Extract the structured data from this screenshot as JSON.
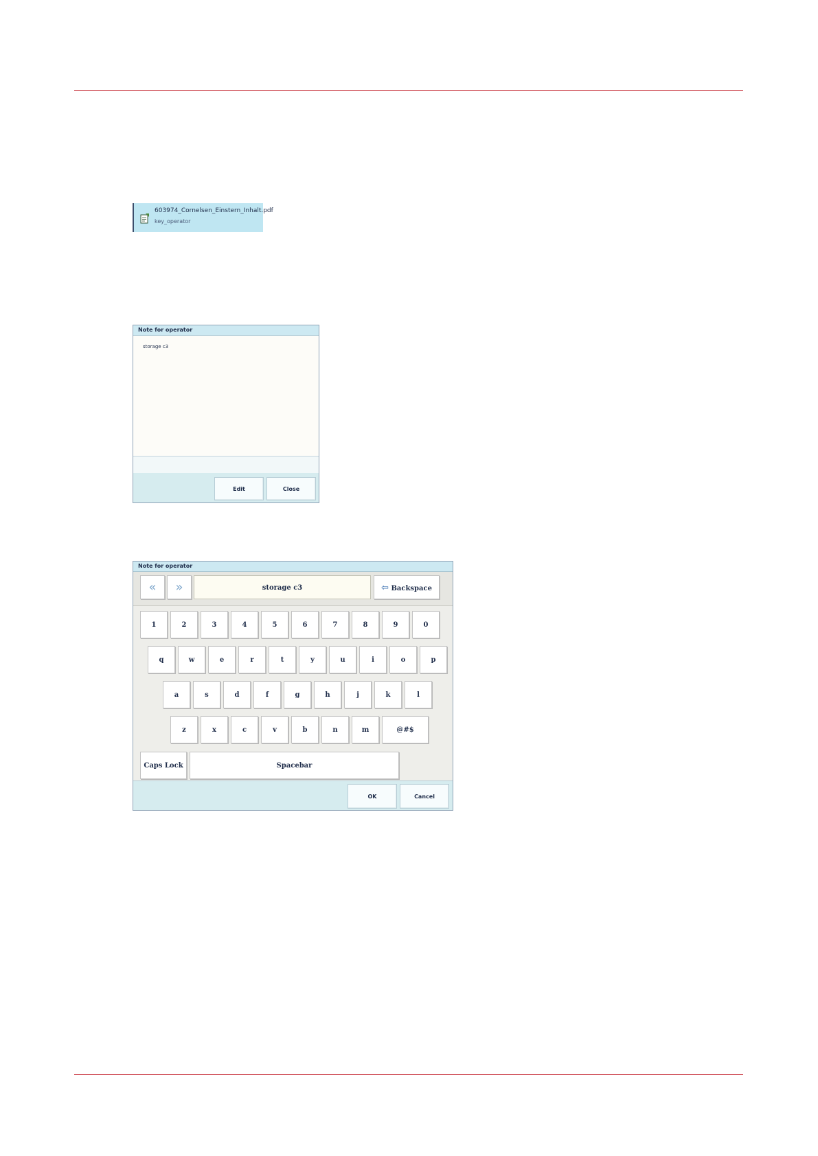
{
  "job": {
    "name": "603974_Cornelsen_Einstern_Inhalt.pdf",
    "owner": "key_operator"
  },
  "note_dialog": {
    "title": "Note for operator",
    "text": "storage c3",
    "edit_label": "Edit",
    "close_label": "Close"
  },
  "keyboard_dialog": {
    "title": "Note for operator",
    "input_value": "storage c3",
    "backspace_label": "Backspace",
    "rows": [
      [
        "1",
        "2",
        "3",
        "4",
        "5",
        "6",
        "7",
        "8",
        "9",
        "0"
      ],
      [
        "q",
        "w",
        "e",
        "r",
        "t",
        "y",
        "u",
        "i",
        "o",
        "p"
      ],
      [
        "a",
        "s",
        "d",
        "f",
        "g",
        "h",
        "j",
        "k",
        "l"
      ],
      [
        "z",
        "x",
        "c",
        "v",
        "b",
        "n",
        "m",
        "@#$"
      ]
    ],
    "caps_lock_label": "Caps Lock",
    "spacebar_label": "Spacebar",
    "ok_label": "OK",
    "cancel_label": "Cancel"
  },
  "colors": {
    "accent_rule": "#c8323c",
    "dialog_title_bg": "#cde9f2",
    "job_selected_bg": "#bfe6f2"
  }
}
